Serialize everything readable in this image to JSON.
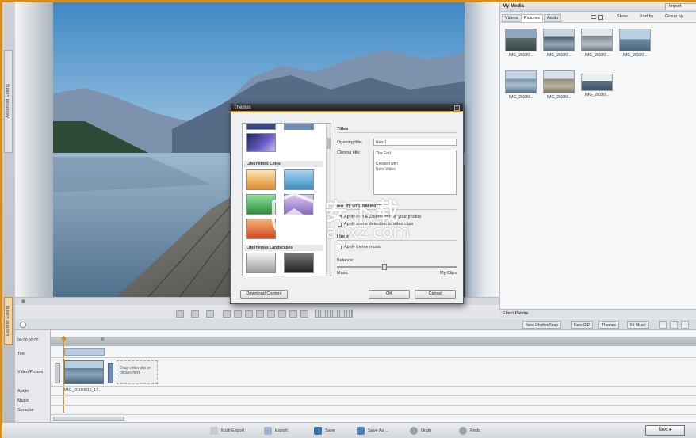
{
  "sidebar": {
    "advanced_editing": "Advanced Editing",
    "express_editing": "Express Editing"
  },
  "media": {
    "title": "My Media",
    "import_label": "Import",
    "tabs": [
      "Videos",
      "Pictures",
      "Audio"
    ],
    "show_label": "Show",
    "sort_label": "Sort by",
    "group_label": "Group by",
    "thumbs": [
      "IMG_20180...",
      "IMG_20180...",
      "IMG_20180...",
      "IMG_20180...",
      "IMG_20180...",
      "IMG_20180...",
      "IMG_20180..."
    ]
  },
  "effect_palette": "Effect Palette",
  "toolbar": {
    "rhythmsnap": "Nero RhythmSnap",
    "nero_pip": "Nero PiP",
    "themes": "Themes",
    "fit_music": "Fit Music"
  },
  "timeline": {
    "timecode": "00:00:00:00",
    "marker": "0:",
    "tracks": [
      "Text",
      "Video/Picture",
      "Audio",
      "Music",
      "Sprache"
    ],
    "clip_caption": "IMG_20180812_17...",
    "drop_hint": "Drag video clip or picture here"
  },
  "bottom": {
    "multi_export": "Multi Export",
    "export": "Export",
    "save": "Save",
    "save_as": "Save As ...",
    "undo": "Undo",
    "redo": "Redo",
    "next": "Next"
  },
  "dialog": {
    "title": "Themes",
    "close": "x",
    "section_cities": "LifeThemes Cities",
    "section_landscapes": "LifeThemes Landscapes",
    "titles_heading": "Titles",
    "opening_label": "Opening title:",
    "opening_value": "Nero1",
    "closing_label": "Closing title:",
    "closing_value": "The End\n\nCreated with\nNero Video",
    "modify_heading": "Modify Original Movie",
    "opt_pan": "Apply Pan & Zoom effect to your photos",
    "opt_scene": "Apply scene detection to video clips",
    "music_heading": "Music",
    "opt_music": "Apply theme music",
    "balance_label": "Balance:",
    "balance_left": "Music",
    "balance_right": "My Clips",
    "download": "Download Content",
    "ok": "OK",
    "cancel": "Cancel"
  },
  "watermark": {
    "brand": "安下载",
    "url": "anxz.com"
  }
}
